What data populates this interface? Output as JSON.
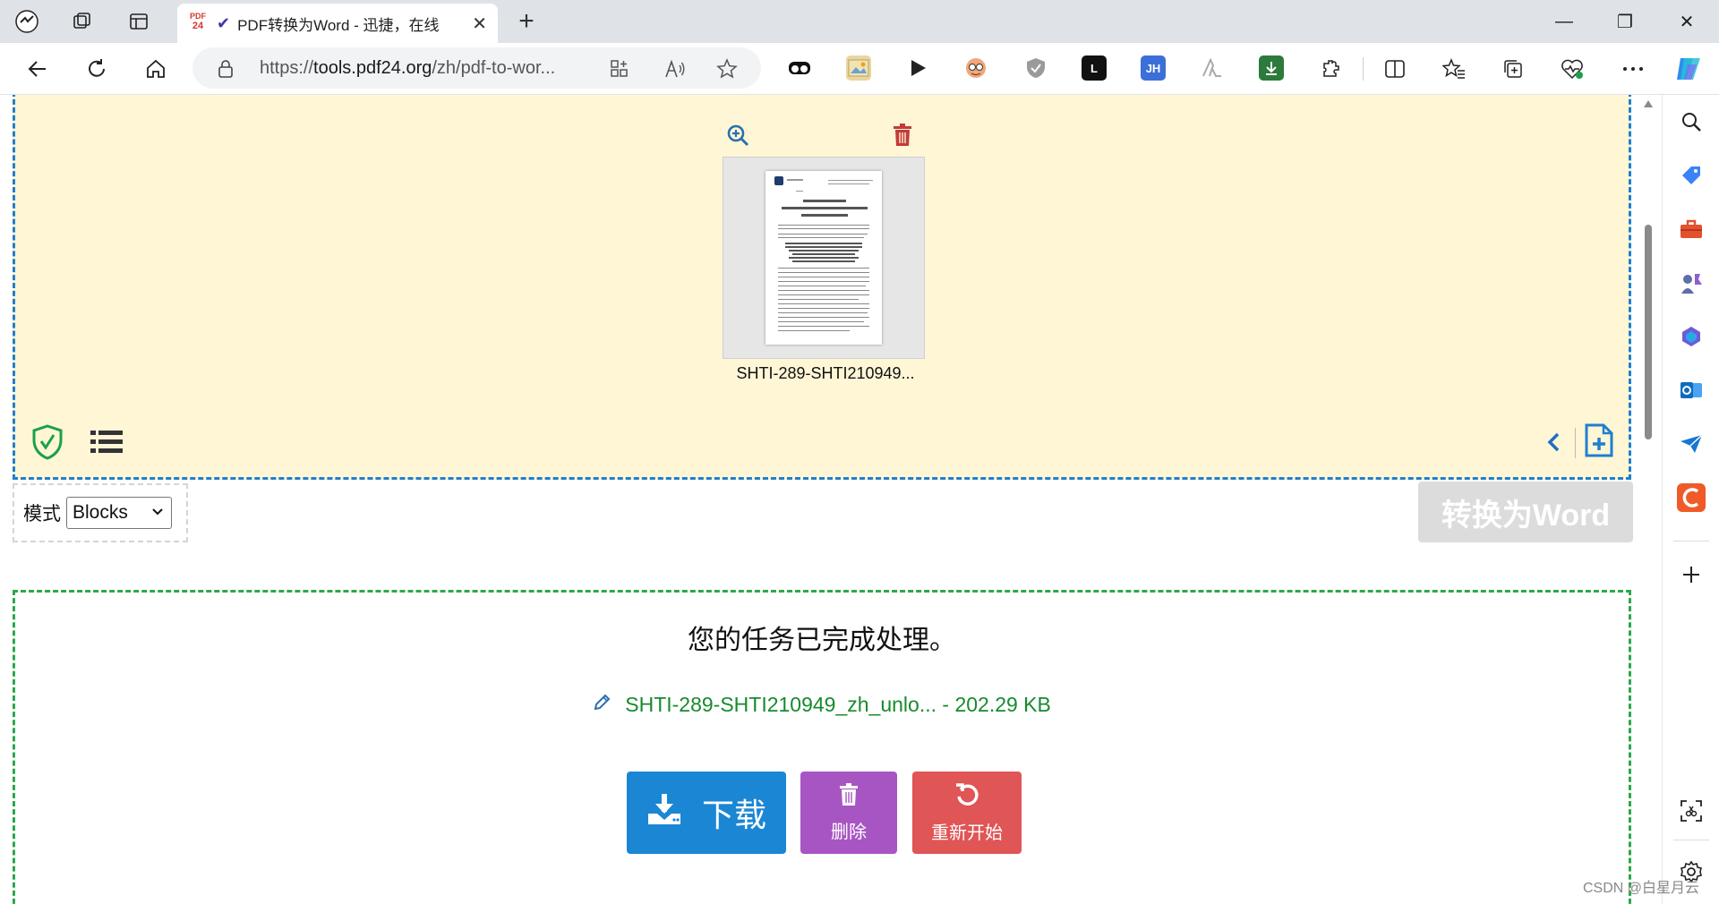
{
  "browser": {
    "tab": {
      "favicon_text": "PDF24",
      "title": "PDF转换为Word - 迅捷，在线",
      "close_glyph": "✕"
    },
    "new_tab_glyph": "+",
    "window_controls": {
      "minimize": "—",
      "restore": "❐",
      "close": "✕"
    },
    "address": {
      "url_prefix": "https://",
      "url_host": "tools.pdf24.org",
      "url_path": "/zh/pdf-to-wor..."
    },
    "extension_labels": {
      "jh": "JH",
      "l": "L"
    }
  },
  "page": {
    "file": {
      "thumbnail_name": "SHTI-289-SHTI210949..."
    },
    "mode": {
      "label": "模式",
      "selected": "Blocks"
    },
    "convert_button": "转换为Word",
    "result": {
      "title": "您的任务已完成处理。",
      "file_link": "SHTI-289-SHTI210949_zh_unlo... - 202.29 KB",
      "buttons": {
        "download": "下载",
        "delete": "删除",
        "restart": "重新开始"
      }
    }
  },
  "watermark": "CSDN @白星月云",
  "colors": {
    "dropzone_bg": "#fff6d5",
    "dropzone_border": "#1f7fd1",
    "result_border": "#2ca84a",
    "download_btn": "#1b86d3",
    "delete_btn": "#a855c4",
    "restart_btn": "#e05555",
    "convert_btn_disabled": "#dcdcdc"
  }
}
